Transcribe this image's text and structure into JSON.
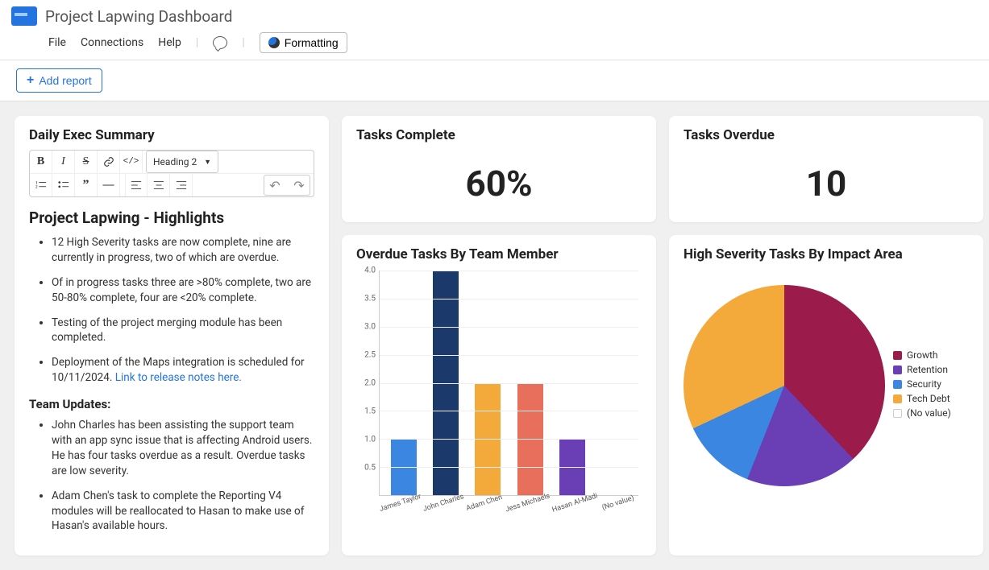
{
  "header": {
    "title": "Project Lapwing Dashboard",
    "menu": {
      "file": "File",
      "connections": "Connections",
      "help": "Help",
      "formatting": "Formatting"
    },
    "add_report": "Add report"
  },
  "exec": {
    "card_title": "Daily Exec Summary",
    "heading_dropdown": "Heading 2",
    "highlights_title": "Project Lapwing - Highlights",
    "bullets": [
      "12 High Severity tasks are now complete, nine are currently in progress, two of which are overdue.",
      "Of in progress tasks three are >80% complete,  two are     50-80% complete, four are <20% complete.",
      "Testing of the project merging module has been completed.",
      "Deployment of the Maps integration is scheduled for 10/11/2024. "
    ],
    "link_text": "Link to release notes here.",
    "team_title": "Team Updates:",
    "team_bullets": [
      "John Charles has been assisting the support team with an app sync issue that is affecting Android users. He has four tasks overdue as a result. Overdue tasks are low severity.",
      "Adam Chen's task to complete the Reporting V4 modules will be reallocated to Hasan to make use of Hasan's available hours."
    ]
  },
  "kpi": {
    "complete_title": "Tasks Complete",
    "complete_value": "60%",
    "overdue_title": "Tasks Overdue",
    "overdue_value": "10"
  },
  "chart_data": [
    {
      "type": "bar",
      "title": "Overdue Tasks By Team Member",
      "ylim": [
        0,
        4
      ],
      "yticks": [
        0.5,
        1.0,
        1.5,
        2.0,
        2.5,
        3.0,
        3.5,
        4.0
      ],
      "categories": [
        "James Taylor",
        "John Charles",
        "Adam Chen",
        "Jess Michaels",
        "Hasan Al-Madi",
        "(No value)"
      ],
      "values": [
        1,
        4,
        2,
        2,
        1,
        0
      ],
      "colors": [
        "#3a86e0",
        "#1b3a6b",
        "#f4a93b",
        "#e86f5c",
        "#6a3fb5",
        "#cccccc"
      ]
    },
    {
      "type": "pie",
      "title": "High Severity Tasks By Impact Area",
      "series": [
        {
          "name": "Growth",
          "value": 38,
          "color": "#9b1b4a"
        },
        {
          "name": "Retention",
          "value": 18,
          "color": "#6a3fb5"
        },
        {
          "name": "Security",
          "value": 12,
          "color": "#3a86e0"
        },
        {
          "name": "Tech Debt",
          "value": 32,
          "color": "#f4a93b"
        },
        {
          "name": "(No value)",
          "value": 0,
          "color": "#ffffff"
        }
      ]
    }
  ]
}
